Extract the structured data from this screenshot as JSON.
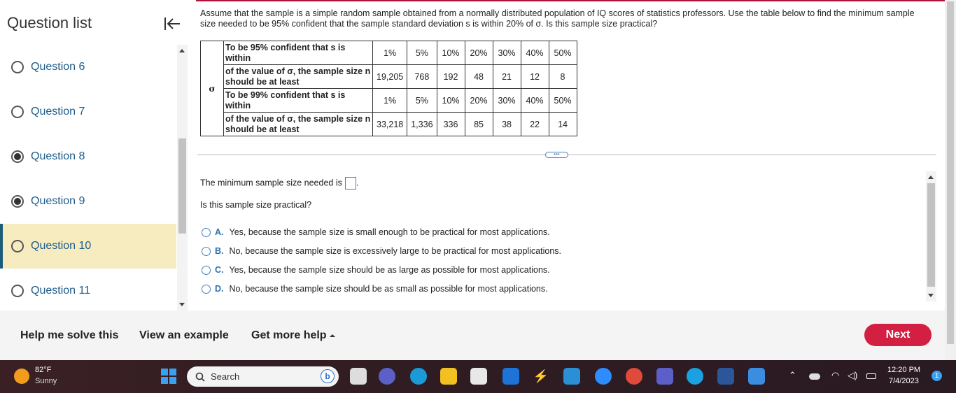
{
  "sidebar": {
    "title": "Question list",
    "items": [
      {
        "label": "Question 6",
        "state": "empty"
      },
      {
        "label": "Question 7",
        "state": "empty"
      },
      {
        "label": "Question 8",
        "state": "filled"
      },
      {
        "label": "Question 9",
        "state": "filled"
      },
      {
        "label": "Question 10",
        "state": "active"
      },
      {
        "label": "Question 11",
        "state": "empty"
      }
    ]
  },
  "question": {
    "text": "Assume that the sample is a simple random sample obtained from a normally distributed population of IQ scores of statistics professors. Use the table below to find the minimum sample size needed to be 95% confident that the sample standard deviation s is within 20% of σ. Is this sample size practical?"
  },
  "table": {
    "sigma": "σ",
    "rows": [
      {
        "desc": "To be 95% confident that s is within",
        "values": [
          "1%",
          "5%",
          "10%",
          "20%",
          "30%",
          "40%",
          "50%"
        ]
      },
      {
        "desc": "of the value of σ, the sample size n should be at least",
        "values": [
          "19,205",
          "768",
          "192",
          "48",
          "21",
          "12",
          "8"
        ]
      },
      {
        "desc": "To be 99% confident that s is within",
        "values": [
          "1%",
          "5%",
          "10%",
          "20%",
          "30%",
          "40%",
          "50%"
        ]
      },
      {
        "desc": "of the value of σ, the sample size n should be at least",
        "values": [
          "33,218",
          "1,336",
          "336",
          "85",
          "38",
          "22",
          "14"
        ]
      }
    ]
  },
  "more_button": "•••",
  "answer": {
    "min_prefix": "The minimum sample size needed is",
    "min_suffix": ".",
    "practical_question": "Is this sample size practical?",
    "options": [
      {
        "letter": "A.",
        "text": "Yes, because the sample size is small enough to be practical for most applications."
      },
      {
        "letter": "B.",
        "text": "No, because the sample size is excessively large to be practical for most applications."
      },
      {
        "letter": "C.",
        "text": "Yes, because the sample size should be as large as possible for most applications."
      },
      {
        "letter": "D.",
        "text": "No, because the sample size should be as small as possible for most applications."
      }
    ]
  },
  "footer": {
    "help": "Help me solve this",
    "example": "View an example",
    "more_help": "Get more help",
    "next": "Next"
  },
  "taskbar": {
    "temp": "82°F",
    "condition": "Sunny",
    "search_placeholder": "Search",
    "time": "12:20 PM",
    "date": "7/4/2023",
    "notifications": "1"
  },
  "colors": {
    "accent": "#d31f42",
    "link": "#1d5c8a",
    "active_bg": "#f7ebc0"
  }
}
